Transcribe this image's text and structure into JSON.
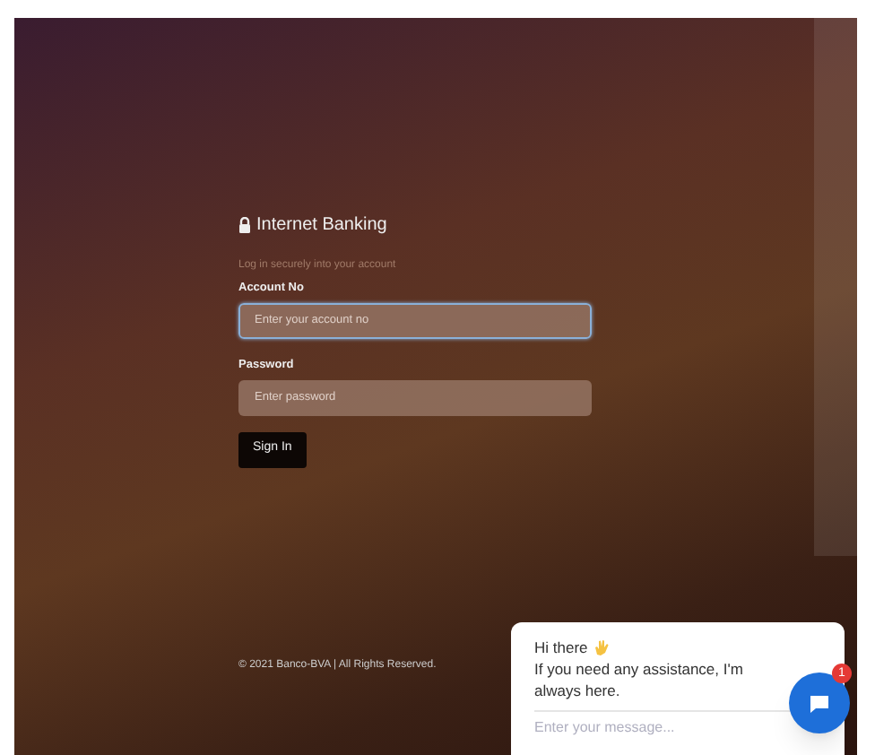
{
  "login": {
    "title": "Internet Banking",
    "subtitle": "Log in securely into your account",
    "fields": [
      {
        "label": "Account No",
        "placeholder": "Enter your account no",
        "focused": true
      },
      {
        "label": "Password",
        "placeholder": "Enter password",
        "focused": false
      }
    ],
    "button": "Sign In"
  },
  "footer": "© 2021 Banco-BVA | All Rights Reserved.",
  "chat": {
    "greeting": "Hi there",
    "message": "If you need any assistance, I'm always here.",
    "placeholder": "Enter your message...",
    "badge": "1"
  }
}
